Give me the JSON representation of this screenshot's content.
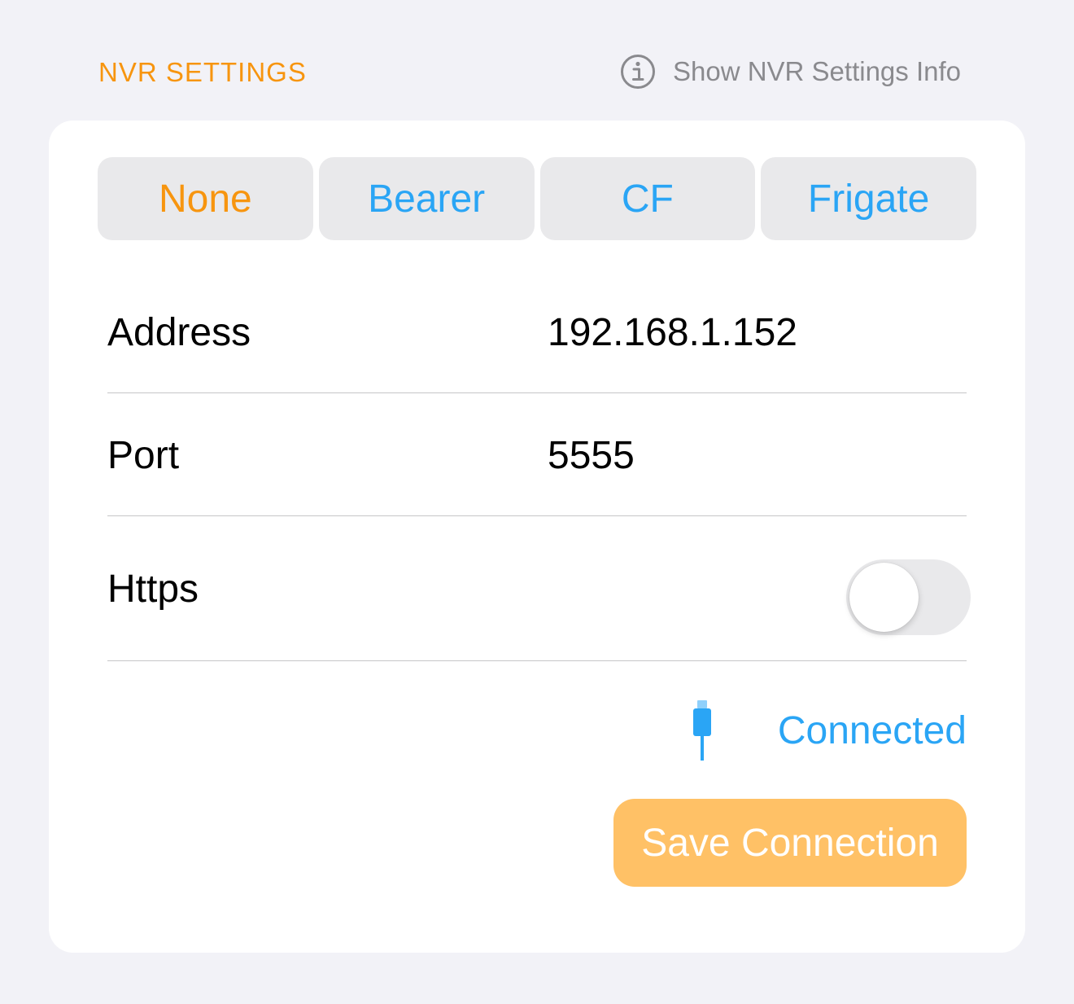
{
  "header": {
    "title": "NVR SETTINGS",
    "info_link_label": "Show NVR Settings Info",
    "info_icon": "info-circle-icon"
  },
  "auth_segments": {
    "options": [
      "None",
      "Bearer",
      "CF",
      "Frigate"
    ],
    "selected": "None"
  },
  "form": {
    "address": {
      "label": "Address",
      "value": "192.168.1.152"
    },
    "port": {
      "label": "Port",
      "value": "5555"
    },
    "https": {
      "label": "Https",
      "enabled": false
    }
  },
  "status": {
    "icon": "cable-plug-icon",
    "label": "Connected"
  },
  "save_button": {
    "label": "Save Connection"
  },
  "colors": {
    "accent_orange": "#f7950f",
    "link_blue": "#2aa5f5",
    "save_button_bg": "#ffc166",
    "background": "#f2f2f7"
  }
}
